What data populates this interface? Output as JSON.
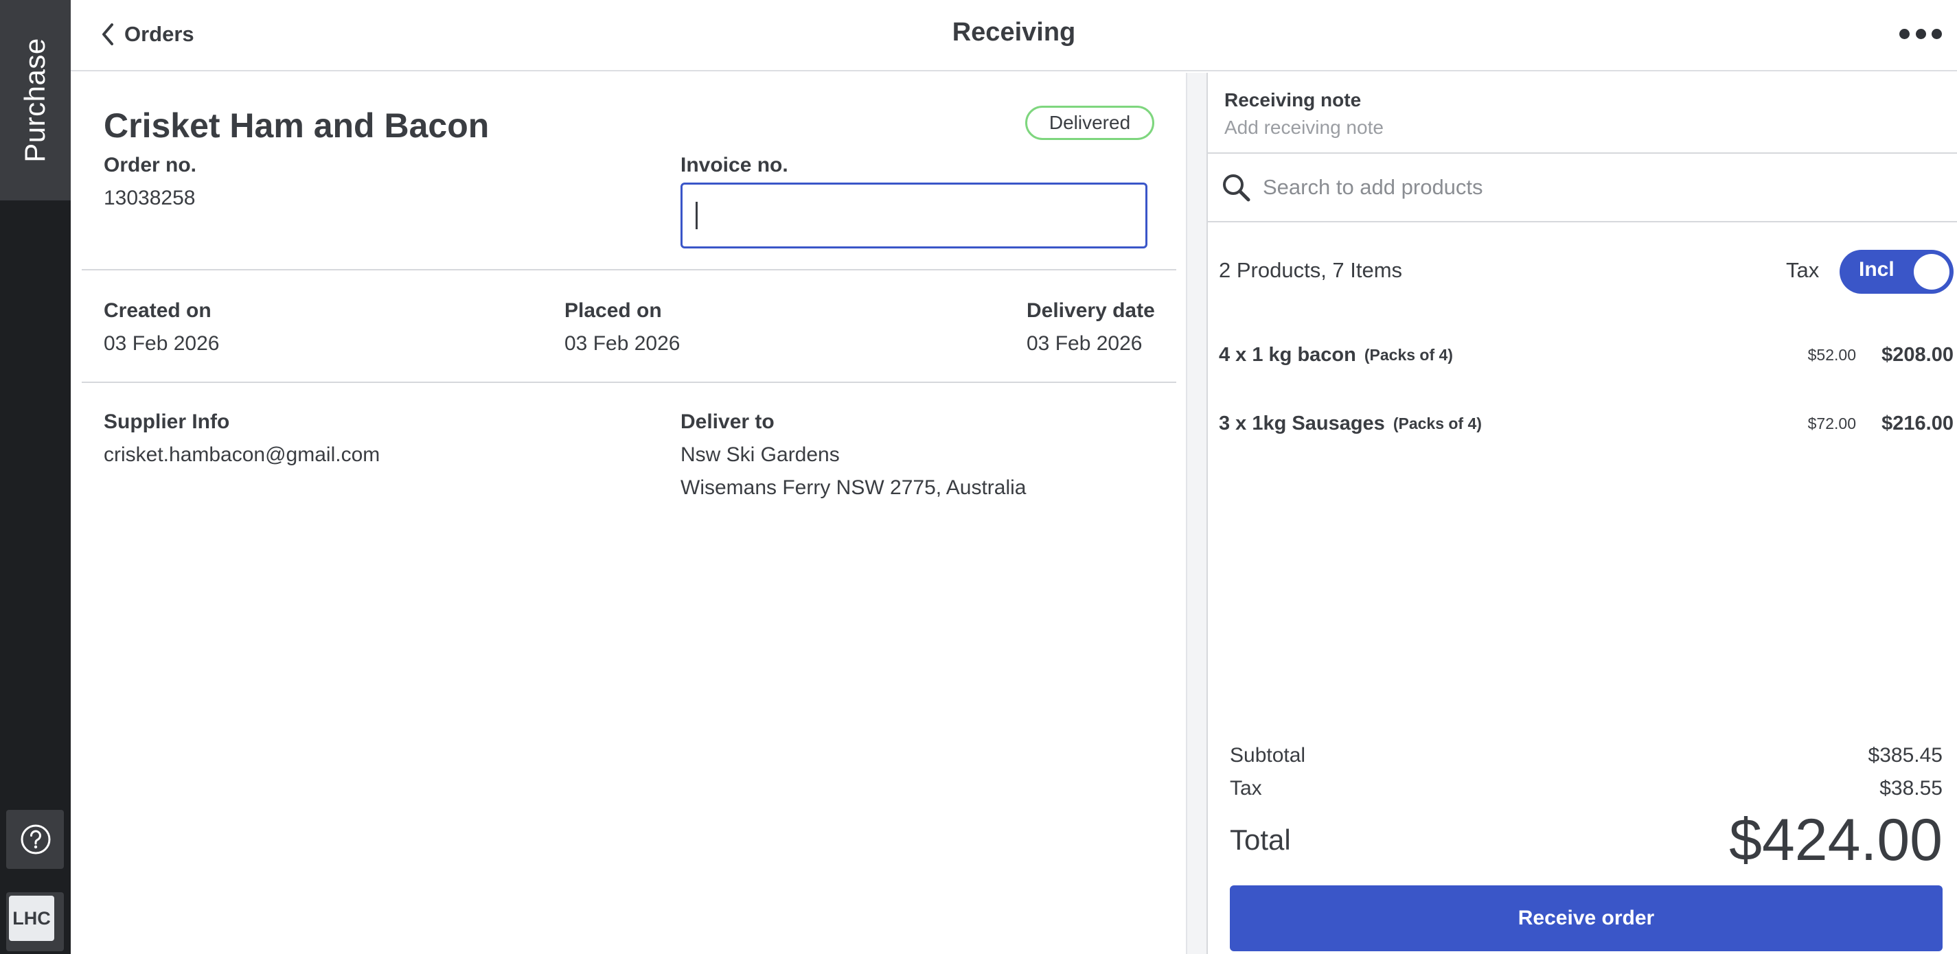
{
  "sidebar": {
    "tab_label": "Purchase",
    "help_icon": "help-circle-icon",
    "avatar_initials": "LHC"
  },
  "header": {
    "back_label": "Orders",
    "back_icon": "chevron-left-icon",
    "title": "Receiving",
    "more_icon": "more-horizontal-icon"
  },
  "order": {
    "supplier_name": "Crisket Ham and Bacon",
    "status": "Delivered",
    "order_no_label": "Order no.",
    "order_no": "13038258",
    "invoice_label": "Invoice no.",
    "invoice_value": "",
    "created_label": "Created on",
    "created_value": "03 Feb 2026",
    "placed_label": "Placed on",
    "placed_value": "03 Feb 2026",
    "delivery_label": "Delivery date",
    "delivery_value": "03 Feb 2026",
    "supplier_info_label": "Supplier Info",
    "supplier_email": "crisket.hambacon@gmail.com",
    "deliver_to_label": "Deliver to",
    "deliver_to_line1": "Nsw Ski Gardens",
    "deliver_to_line2": "Wisemans Ferry NSW 2775, Australia"
  },
  "receiving": {
    "note_label": "Receiving note",
    "note_placeholder": "Add receiving note",
    "search_placeholder": "Search to add products",
    "summary": "2 Products, 7 Items",
    "tax_label": "Tax",
    "tax_toggle_label": "Incl",
    "items": [
      {
        "name": "4 x 1 kg bacon",
        "pack": "(Packs of 4)",
        "unit_price": "$52.00",
        "total": "$208.00"
      },
      {
        "name": "3 x 1kg Sausages",
        "pack": "(Packs of 4)",
        "unit_price": "$72.00",
        "total": "$216.00"
      }
    ],
    "subtotal_label": "Subtotal",
    "subtotal_value": "$385.45",
    "tax_row_label": "Tax",
    "tax_row_value": "$38.55",
    "total_label": "Total",
    "total_value": "$424.00",
    "receive_button": "Receive order"
  },
  "colors": {
    "sidebar_bg": "#1d1f22",
    "accent": "#3a56c8",
    "status_border": "#7ed67e"
  }
}
